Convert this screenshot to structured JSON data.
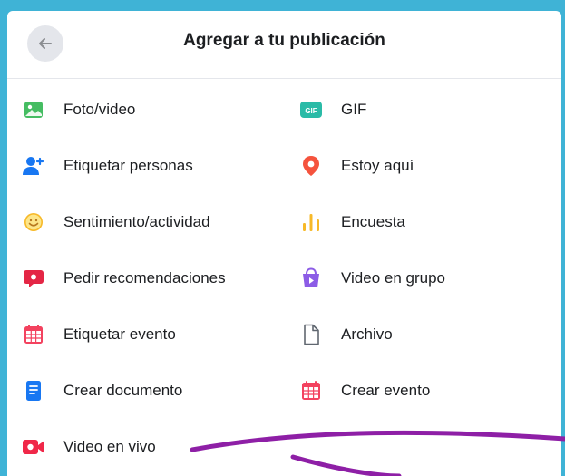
{
  "header": {
    "title": "Agregar a tu publicación",
    "back_icon": "arrow-left-icon"
  },
  "options": {
    "left": [
      {
        "label": "Foto/video",
        "icon": "photo-icon",
        "color": "#45bd62"
      },
      {
        "label": "Etiquetar personas",
        "icon": "tag-people-icon",
        "color": "#1877f2"
      },
      {
        "label": "Sentimiento/actividad",
        "icon": "smile-icon",
        "color": "#f7b928"
      },
      {
        "label": "Pedir recomendaciones",
        "icon": "recommendation-icon",
        "color": "#e42645"
      },
      {
        "label": "Etiquetar evento",
        "icon": "event-tag-icon",
        "color": "#f3425f"
      },
      {
        "label": "Crear documento",
        "icon": "document-icon",
        "color": "#1877f2"
      },
      {
        "label": "Video en vivo",
        "icon": "live-video-icon",
        "color": "#f02849"
      }
    ],
    "right": [
      {
        "label": "GIF",
        "icon": "gif-icon",
        "color": "#2abba7"
      },
      {
        "label": "Estoy aquí",
        "icon": "location-pin-icon",
        "color": "#f5533d"
      },
      {
        "label": "Encuesta",
        "icon": "poll-icon",
        "color": "#f7b928"
      },
      {
        "label": "Video en grupo",
        "icon": "group-video-icon",
        "color": "#8c5ce6"
      },
      {
        "label": "Archivo",
        "icon": "file-icon",
        "color": "#606770"
      },
      {
        "label": "Crear evento",
        "icon": "calendar-icon",
        "color": "#f3425f"
      }
    ]
  },
  "annotation": {
    "arrow_color": "#8e1fa6"
  }
}
